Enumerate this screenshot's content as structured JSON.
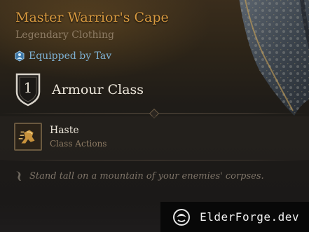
{
  "item": {
    "name": "Master Warrior's Cape",
    "subtitle": "Legendary Clothing",
    "equipped": "Equipped by Tav",
    "armour_class_value": "1",
    "armour_class_label": "Armour Class"
  },
  "action": {
    "name": "Haste",
    "type": "Class Actions"
  },
  "flavor": "Stand tall on a mountain of your enemies' corpses.",
  "watermark": "ElderForge.dev",
  "colors": {
    "rarity_legendary": "#d89a40",
    "equipped_text": "#7fb2d4",
    "subtitle_text": "#8d7b64"
  },
  "icons": {
    "item_art": "cape-image",
    "equipped": "person-icon",
    "armour_class": "shield-icon",
    "action": "haste-icon",
    "flavor": "quill-icon",
    "watermark_logo": "elderforge-logo-icon"
  }
}
